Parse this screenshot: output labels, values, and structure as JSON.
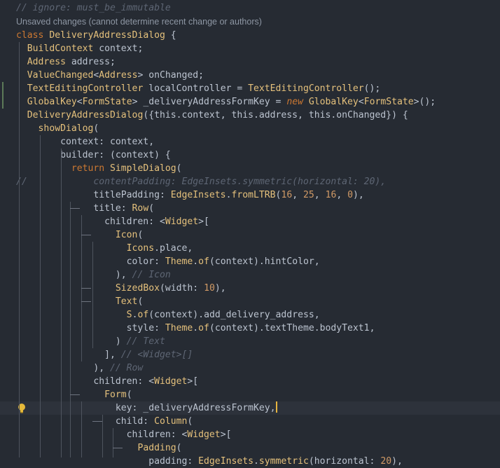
{
  "editor": {
    "colors": {
      "background": "#262b33",
      "current_line": "#2d323b",
      "text": "#bcc4d0",
      "keyword": "#cc7832",
      "type": "#e5c17c",
      "number": "#d19a66",
      "comment": "#5e6674",
      "caret": "#e7b53f"
    },
    "blame_annotation": "Unsaved changes (cannot determine recent change or authors)",
    "intention_icon": "lightbulb-icon",
    "lines": [
      {
        "id": "l0",
        "tokens": [
          [
            "cmt",
            "// ignore: must_be_immutable"
          ]
        ]
      },
      {
        "id": "l1",
        "tokens": [
          [
            "kw",
            "class "
          ],
          [
            "cls",
            "DeliveryAddressDialog"
          ],
          [
            "",
            " {"
          ]
        ]
      },
      {
        "id": "l2",
        "tokens": [
          [
            "",
            "  "
          ],
          [
            "cls",
            "BuildContext"
          ],
          [
            "",
            " context;"
          ]
        ]
      },
      {
        "id": "l3",
        "tokens": [
          [
            "",
            "  "
          ],
          [
            "cls",
            "Address"
          ],
          [
            "",
            " address;"
          ]
        ]
      },
      {
        "id": "l4",
        "tokens": [
          [
            "",
            "  "
          ],
          [
            "cls",
            "ValueChanged"
          ],
          [
            "",
            "<"
          ],
          [
            "cls",
            "Address"
          ],
          [
            "",
            "> onChanged;"
          ]
        ]
      },
      {
        "id": "l5",
        "tokens": [
          [
            "",
            "  "
          ],
          [
            "cls",
            "TextEditingController"
          ],
          [
            "",
            " localController = "
          ],
          [
            "cls",
            "TextEditingController"
          ],
          [
            "",
            "();"
          ]
        ]
      },
      {
        "id": "l6",
        "tokens": [
          [
            "",
            "  "
          ],
          [
            "cls",
            "GlobalKey"
          ],
          [
            "",
            "<"
          ],
          [
            "cls",
            "FormState"
          ],
          [
            "",
            "> _deliveryAddressFormKey = "
          ],
          [
            "kwi",
            "new"
          ],
          [
            "",
            " "
          ],
          [
            "cls",
            "GlobalKey"
          ],
          [
            "",
            "<"
          ],
          [
            "cls",
            "FormState"
          ],
          [
            "",
            ">();"
          ]
        ]
      },
      {
        "id": "l7",
        "tokens": [
          [
            "",
            "  "
          ],
          [
            "fn",
            "DeliveryAddressDialog"
          ],
          [
            "",
            "({this.context, this.address, this.onChanged}) {"
          ]
        ]
      },
      {
        "id": "l8",
        "tokens": [
          [
            "",
            "    "
          ],
          [
            "fn",
            "showDialog"
          ],
          [
            "",
            "("
          ]
        ]
      },
      {
        "id": "l9",
        "tokens": [
          [
            "",
            "        context: context,"
          ]
        ]
      },
      {
        "id": "l10",
        "tokens": [
          [
            "",
            "        builder: (context) {"
          ]
        ]
      },
      {
        "id": "l11",
        "tokens": [
          [
            "",
            "          "
          ],
          [
            "kw",
            "return "
          ],
          [
            "fn",
            "SimpleDialog"
          ],
          [
            "",
            "("
          ]
        ]
      },
      {
        "id": "l12",
        "tokens": [
          [
            "cmt",
            "//            contentPadding: EdgeInsets.symmetric(horizontal: 20),"
          ]
        ]
      },
      {
        "id": "l13",
        "tokens": [
          [
            "",
            "              titlePadding: "
          ],
          [
            "cls",
            "EdgeInsets"
          ],
          [
            "",
            "."
          ],
          [
            "fn",
            "fromLTRB"
          ],
          [
            "",
            "("
          ],
          [
            "num",
            "16"
          ],
          [
            "",
            ", "
          ],
          [
            "num",
            "25"
          ],
          [
            "",
            ", "
          ],
          [
            "num",
            "16"
          ],
          [
            "",
            ", "
          ],
          [
            "num",
            "0"
          ],
          [
            "",
            "),"
          ]
        ]
      },
      {
        "id": "l14",
        "tokens": [
          [
            "",
            "              title: "
          ],
          [
            "fn",
            "Row"
          ],
          [
            "",
            "("
          ]
        ]
      },
      {
        "id": "l15",
        "tokens": [
          [
            "",
            "                children: <"
          ],
          [
            "cls",
            "Widget"
          ],
          [
            "",
            ">["
          ]
        ]
      },
      {
        "id": "l16",
        "tokens": [
          [
            "",
            "                  "
          ],
          [
            "fn",
            "Icon"
          ],
          [
            "",
            "("
          ]
        ]
      },
      {
        "id": "l17",
        "tokens": [
          [
            "",
            "                    "
          ],
          [
            "cls",
            "Icons"
          ],
          [
            "",
            ".place,"
          ]
        ]
      },
      {
        "id": "l18",
        "tokens": [
          [
            "",
            "                    color: "
          ],
          [
            "cls",
            "Theme"
          ],
          [
            "",
            "."
          ],
          [
            "fn",
            "of"
          ],
          [
            "",
            "(context).hintColor,"
          ]
        ]
      },
      {
        "id": "l19",
        "tokens": [
          [
            "",
            "                  ), "
          ],
          [
            "cmt",
            "// Icon"
          ]
        ]
      },
      {
        "id": "l20",
        "tokens": [
          [
            "",
            "                  "
          ],
          [
            "fn",
            "SizedBox"
          ],
          [
            "",
            "(width: "
          ],
          [
            "num",
            "10"
          ],
          [
            "",
            "),"
          ]
        ]
      },
      {
        "id": "l21",
        "tokens": [
          [
            "",
            "                  "
          ],
          [
            "fn",
            "Text"
          ],
          [
            "",
            "("
          ]
        ]
      },
      {
        "id": "l22",
        "tokens": [
          [
            "",
            "                    "
          ],
          [
            "cls",
            "S"
          ],
          [
            "",
            "."
          ],
          [
            "fn",
            "of"
          ],
          [
            "",
            "(context).add_delivery_address,"
          ]
        ]
      },
      {
        "id": "l23",
        "tokens": [
          [
            "",
            "                    style: "
          ],
          [
            "cls",
            "Theme"
          ],
          [
            "",
            "."
          ],
          [
            "fn",
            "of"
          ],
          [
            "",
            "(context).textTheme.bodyText1,"
          ]
        ]
      },
      {
        "id": "l24",
        "tokens": [
          [
            "",
            "                  ) "
          ],
          [
            "cmt",
            "// Text"
          ]
        ]
      },
      {
        "id": "l25",
        "tokens": [
          [
            "",
            "                ], "
          ],
          [
            "cmt",
            "// <Widget>[]"
          ]
        ]
      },
      {
        "id": "l26",
        "tokens": [
          [
            "",
            "              ), "
          ],
          [
            "cmt",
            "// Row"
          ]
        ]
      },
      {
        "id": "l27",
        "tokens": [
          [
            "",
            "              children: <"
          ],
          [
            "cls",
            "Widget"
          ],
          [
            "",
            ">["
          ]
        ]
      },
      {
        "id": "l28",
        "tokens": [
          [
            "",
            "                "
          ],
          [
            "fn",
            "Form"
          ],
          [
            "",
            "("
          ]
        ]
      },
      {
        "id": "l29",
        "tokens": [
          [
            "",
            "                  key: _deliveryAddressFormKey,"
          ]
        ]
      },
      {
        "id": "l30",
        "tokens": [
          [
            "",
            "                  child: "
          ],
          [
            "fn",
            "Column"
          ],
          [
            "",
            "("
          ]
        ]
      },
      {
        "id": "l31",
        "tokens": [
          [
            "",
            "                    children: <"
          ],
          [
            "cls",
            "Widget"
          ],
          [
            "",
            ">["
          ]
        ]
      },
      {
        "id": "l32",
        "tokens": [
          [
            "",
            "                      "
          ],
          [
            "fn",
            "Padding"
          ],
          [
            "",
            "("
          ]
        ]
      },
      {
        "id": "l33",
        "tokens": [
          [
            "",
            "                        padding: "
          ],
          [
            "cls",
            "EdgeInsets"
          ],
          [
            "",
            "."
          ],
          [
            "fn",
            "symmetric"
          ],
          [
            "",
            "(horizontal: "
          ],
          [
            "num",
            "20"
          ],
          [
            "",
            "),"
          ]
        ]
      }
    ]
  }
}
